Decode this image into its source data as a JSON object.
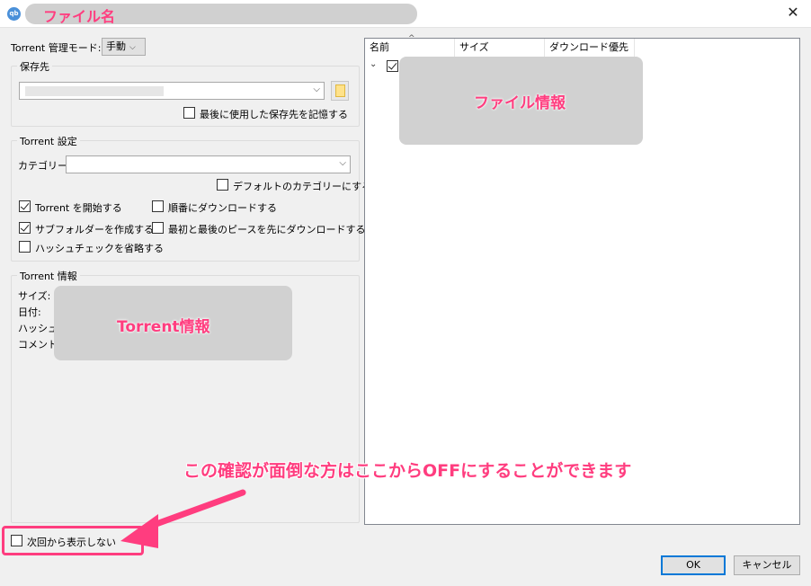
{
  "window": {
    "title": "ファイル名",
    "app_icon": "qb",
    "close_glyph": "✕"
  },
  "left": {
    "mode_label": "Torrent 管理モード:",
    "mode_value": "手動",
    "save_group_title": "保存先",
    "remember_label": "最後に使用した保存先を記憶する",
    "torrent_settings_title": "Torrent 設定",
    "category_label": "カテゴリー:",
    "default_category_label": "デフォルトのカテゴリーにする",
    "start_torrent_label": "Torrent を開始する",
    "sequential_label": "順番にダウンロードする",
    "create_subfolder_label": "サブフォルダーを作成する",
    "first_last_label": "最初と最後のピースを先にダウンロードする",
    "skip_hash_label": "ハッシュチェックを省略する",
    "torrent_info_title": "Torrent 情報",
    "info_size": "サイズ:",
    "info_date": "日付:",
    "info_hash": "ハッシュ:",
    "info_comment": "コメント:",
    "info_mask_label": "Torrent情報"
  },
  "right": {
    "columns": [
      "名前",
      "サイズ",
      "ダウンロード優先度"
    ],
    "file_mask_label": "ファイル情報"
  },
  "checkboxes": {
    "remember": false,
    "default_category": false,
    "start_torrent": true,
    "sequential": false,
    "create_subfolder": true,
    "first_last": false,
    "skip_hash": false,
    "dont_show_again": false,
    "file_root": true
  },
  "footer": {
    "dont_show_again_label": "次回から表示しない",
    "ok_label": "OK",
    "cancel_label": "キャンセル"
  },
  "annotation": {
    "text": "この確認が面倒な方はここからOFFにすることができます",
    "color": "#ff3d7f"
  }
}
